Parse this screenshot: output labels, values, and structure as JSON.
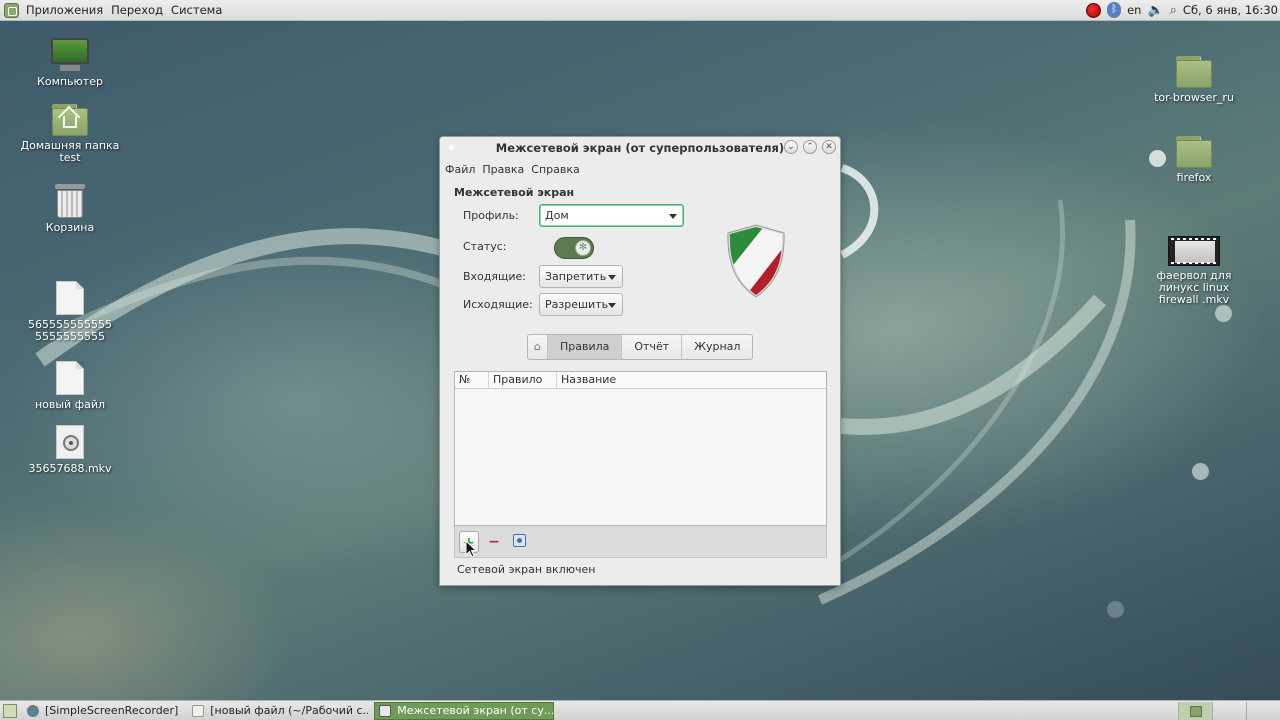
{
  "top_panel": {
    "menus": [
      "Приложения",
      "Переход",
      "Система"
    ],
    "lang": "en",
    "clock": "Сб, 6 янв, 16:30",
    "tray_icons": [
      "record-icon",
      "bluetooth-icon",
      "volume-icon",
      "network-icon"
    ]
  },
  "desktop": {
    "icons": [
      {
        "label": "Компьютер",
        "icon": "computer-icon"
      },
      {
        "label": "Домашняя папка test",
        "icon": "home-folder-icon"
      },
      {
        "label": "Корзина",
        "icon": "trash-icon"
      },
      {
        "label": "5655555555555555555555",
        "icon": "file-icon"
      },
      {
        "label": "новый файл",
        "icon": "file-icon"
      },
      {
        "label": "35657688.mkv",
        "icon": "video-file-icon"
      },
      {
        "label": "tor-browser_ru",
        "icon": "folder-icon"
      },
      {
        "label": "firefox",
        "icon": "folder-icon"
      },
      {
        "label": "фаервол для линукс linux firewall .mkv",
        "icon": "video-thumbnail-icon"
      }
    ]
  },
  "window": {
    "title": "Межсетевой экран (от суперпользователя)",
    "menu": [
      "Файл",
      "Правка",
      "Справка"
    ],
    "section_title": "Межсетевой экран",
    "profile_label": "Профиль:",
    "profile_value": "Дом",
    "status_label": "Статус:",
    "status_on": true,
    "incoming_label": "Входящие:",
    "incoming_value": "Запретить",
    "outgoing_label": "Исходящие:",
    "outgoing_value": "Разрешить",
    "tabs": [
      "Правила",
      "Отчёт",
      "Журнал"
    ],
    "active_tab": "Правила",
    "table_headers": [
      "№",
      "Правило",
      "Название"
    ],
    "table_rows": [],
    "toolbar": {
      "add": "+",
      "remove": "−"
    },
    "statusbar": "Сетевой экран включен",
    "colors": {
      "accent": "#4caf7a",
      "toggle": "#5d7a53",
      "shield_green": "#2e8b3e",
      "shield_red": "#b3202b"
    }
  },
  "taskbar": {
    "items": [
      {
        "label": "[SimpleScreenRecorder]",
        "icon": "recorder-icon",
        "active": false
      },
      {
        "label": "[новый файл (~/Рабочий с...",
        "icon": "text-editor-icon",
        "active": false
      },
      {
        "label": "Межсетевой экран (от су...",
        "icon": "firewall-icon",
        "active": true
      }
    ]
  }
}
